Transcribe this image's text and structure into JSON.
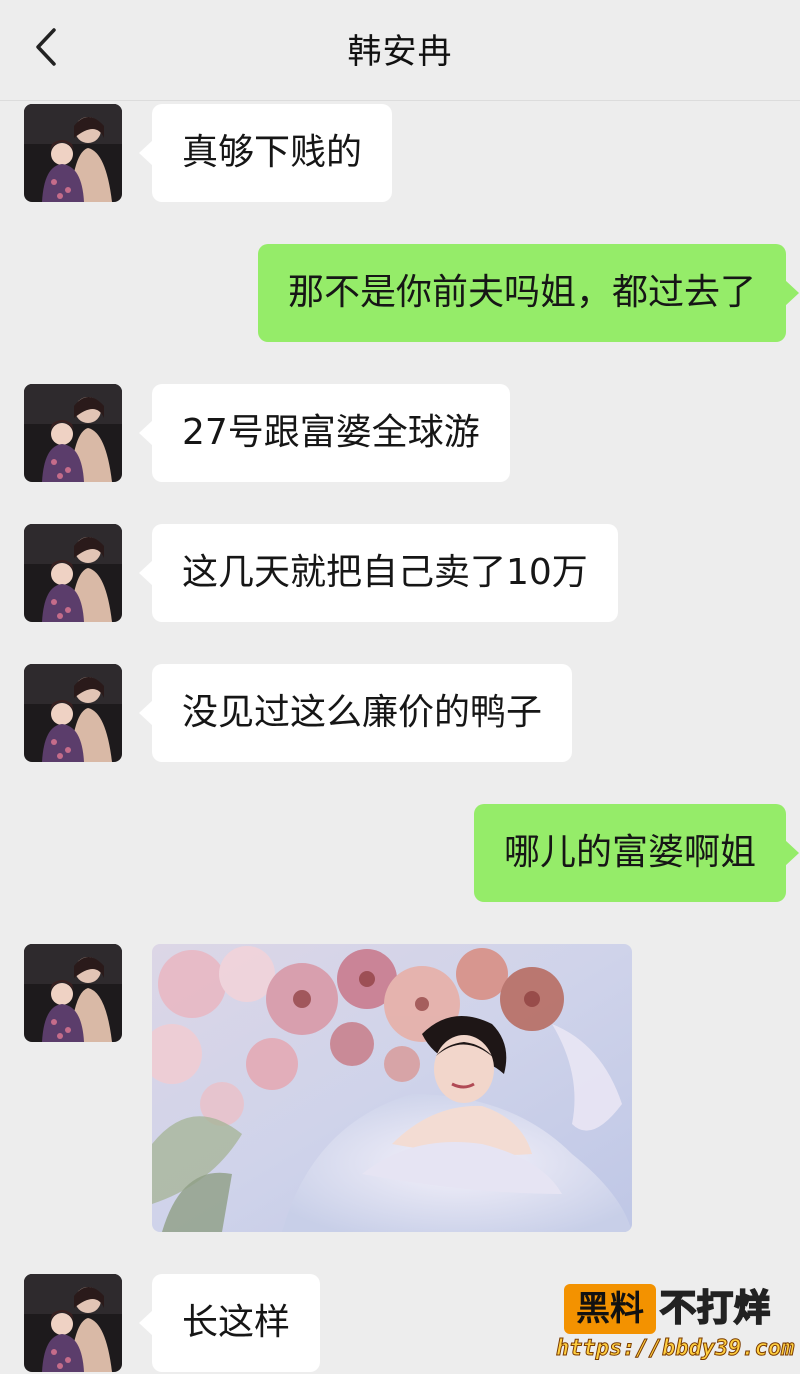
{
  "header": {
    "title": "韩安冉",
    "back_icon": "chevron-left-icon"
  },
  "colors": {
    "background": "#ededed",
    "incoming_bubble": "#ffffff",
    "outgoing_bubble": "#95ec69"
  },
  "messages": [
    {
      "side": "left",
      "text": "真够下贱的"
    },
    {
      "side": "right",
      "text": "那不是你前夫吗姐，都过去了"
    },
    {
      "side": "left",
      "text": "27号跟富婆全球游"
    },
    {
      "side": "left",
      "text": "这几天就把自己卖了10万"
    },
    {
      "side": "left",
      "text": "没见过这么廉价的鸭子"
    },
    {
      "side": "right",
      "text": "哪儿的富婆啊姐"
    },
    {
      "side": "left",
      "type": "image",
      "image": "photo-of-woman-among-flowers"
    },
    {
      "side": "left",
      "text": "长这样"
    }
  ],
  "watermark": {
    "boxed": "黑料",
    "suffix": "不打烊",
    "url": "https://bbdy39.com"
  }
}
